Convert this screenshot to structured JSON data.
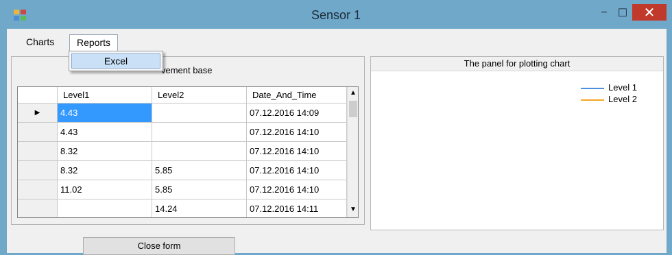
{
  "window": {
    "title": "Sensor 1",
    "minimize_glyph": "−",
    "maximize_glyph": "☐",
    "close_glyph": "✕"
  },
  "menu": {
    "items": [
      {
        "label": "Charts"
      },
      {
        "label": "Reports"
      }
    ],
    "reports_dropdown": [
      {
        "label": "Excel"
      }
    ]
  },
  "left_panel": {
    "title": "vement base",
    "table": {
      "columns": [
        "Level1",
        "Level2",
        "Date_And_Time"
      ],
      "rows": [
        {
          "indicator": "▶",
          "Level1": "4.43",
          "Level2": "",
          "Date_And_Time": "07.12.2016 14:09"
        },
        {
          "indicator": "",
          "Level1": "4.43",
          "Level2": "",
          "Date_And_Time": "07.12.2016 14:10"
        },
        {
          "indicator": "",
          "Level1": "8.32",
          "Level2": "",
          "Date_And_Time": "07.12.2016 14:10"
        },
        {
          "indicator": "",
          "Level1": "8.32",
          "Level2": "5.85",
          "Date_And_Time": "07.12.2016 14:10"
        },
        {
          "indicator": "",
          "Level1": "11.02",
          "Level2": "5.85",
          "Date_And_Time": "07.12.2016 14:10"
        },
        {
          "indicator": "",
          "Level1": "",
          "Level2": "14.24",
          "Date_And_Time": "07.12.2016 14:11"
        }
      ]
    }
  },
  "right_panel": {
    "title": "The panel for plotting chart",
    "legend": [
      {
        "name": "Level 1",
        "color": "#4a90e2"
      },
      {
        "name": "Level 2",
        "color": "#f5a623"
      }
    ]
  },
  "buttons": {
    "close_form": "Close form"
  },
  "colors": {
    "titlebar": "#6fa8c9",
    "selection": "#3399ff",
    "close_button": "#c0392b"
  }
}
